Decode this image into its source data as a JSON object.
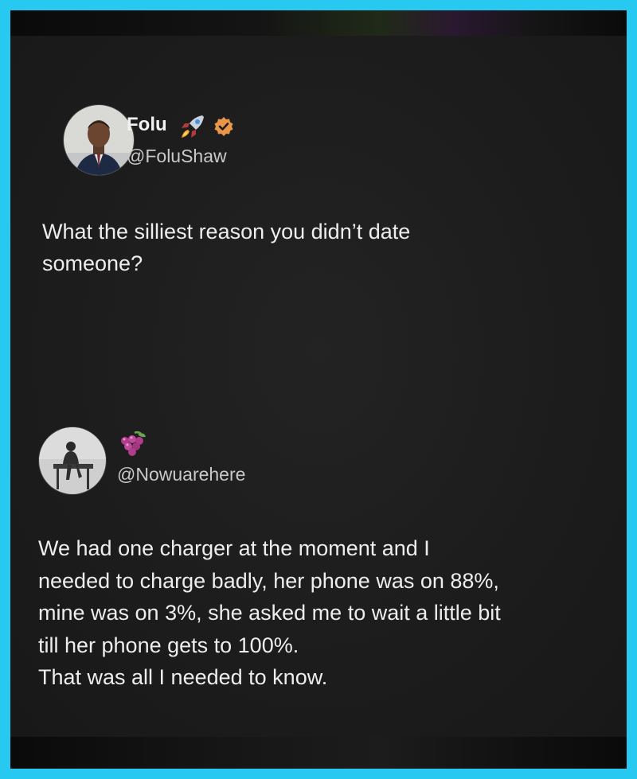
{
  "post": {
    "author_name": "Folu",
    "author_handle": "@FoluShaw",
    "name_emoji_icon": "rocket-icon",
    "verified_icon": "verified-badge-icon",
    "verified_color": "#e8964a",
    "text": "What the silliest reason you didn’t date\nsomeone?"
  },
  "reply": {
    "author_emoji_icon": "grapes-icon",
    "author_handle": "@Nowuarehere",
    "text": "We had one charger at the moment and I\nneeded to charge badly, her phone was on 88%,\nmine was on 3%, she asked me to wait a little bit\ntill her phone gets to 100%.\nThat was all I needed to know."
  },
  "colors": {
    "border": "#27c9f0",
    "background": "#1b1b1b"
  }
}
